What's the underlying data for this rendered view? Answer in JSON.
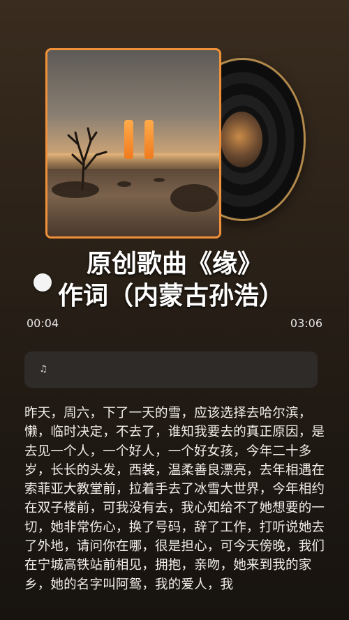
{
  "song": {
    "title_line1": "原创歌曲《缘》",
    "title_line2": "作词（内蒙古孙浩）"
  },
  "player": {
    "current_time": "00:04",
    "total_time": "03:06",
    "progress": 0.02,
    "state": "playing",
    "accent_color": "#f0913a"
  },
  "icons": {
    "pause": "pause-icon",
    "lyrics": "music-note-icon"
  },
  "lyrics_card": {
    "icon": "♫"
  },
  "description": "昨天，周六，下了一天的雪，应该选择去哈尔滨，懒，临时决定，不去了，谁知我要去的真正原因，是去见一个人，一个好人，一个好女孩，今年二十多岁，长长的头发，西装，温柔善良漂亮，去年相遇在索菲亚大教堂前，拉着手去了冰雪大世界，今年相约在双子楼前，可我没有去，我心知给不了她想要的一切，她非常伤心，换了号码，辞了工作，打听说她去了外地，请问你在哪，很是担心，可今天傍晚，我们在宁城高铁站前相见，拥抱，亲吻，她来到我的家乡，她的名字叫阿鸳，我的爱人，我"
}
